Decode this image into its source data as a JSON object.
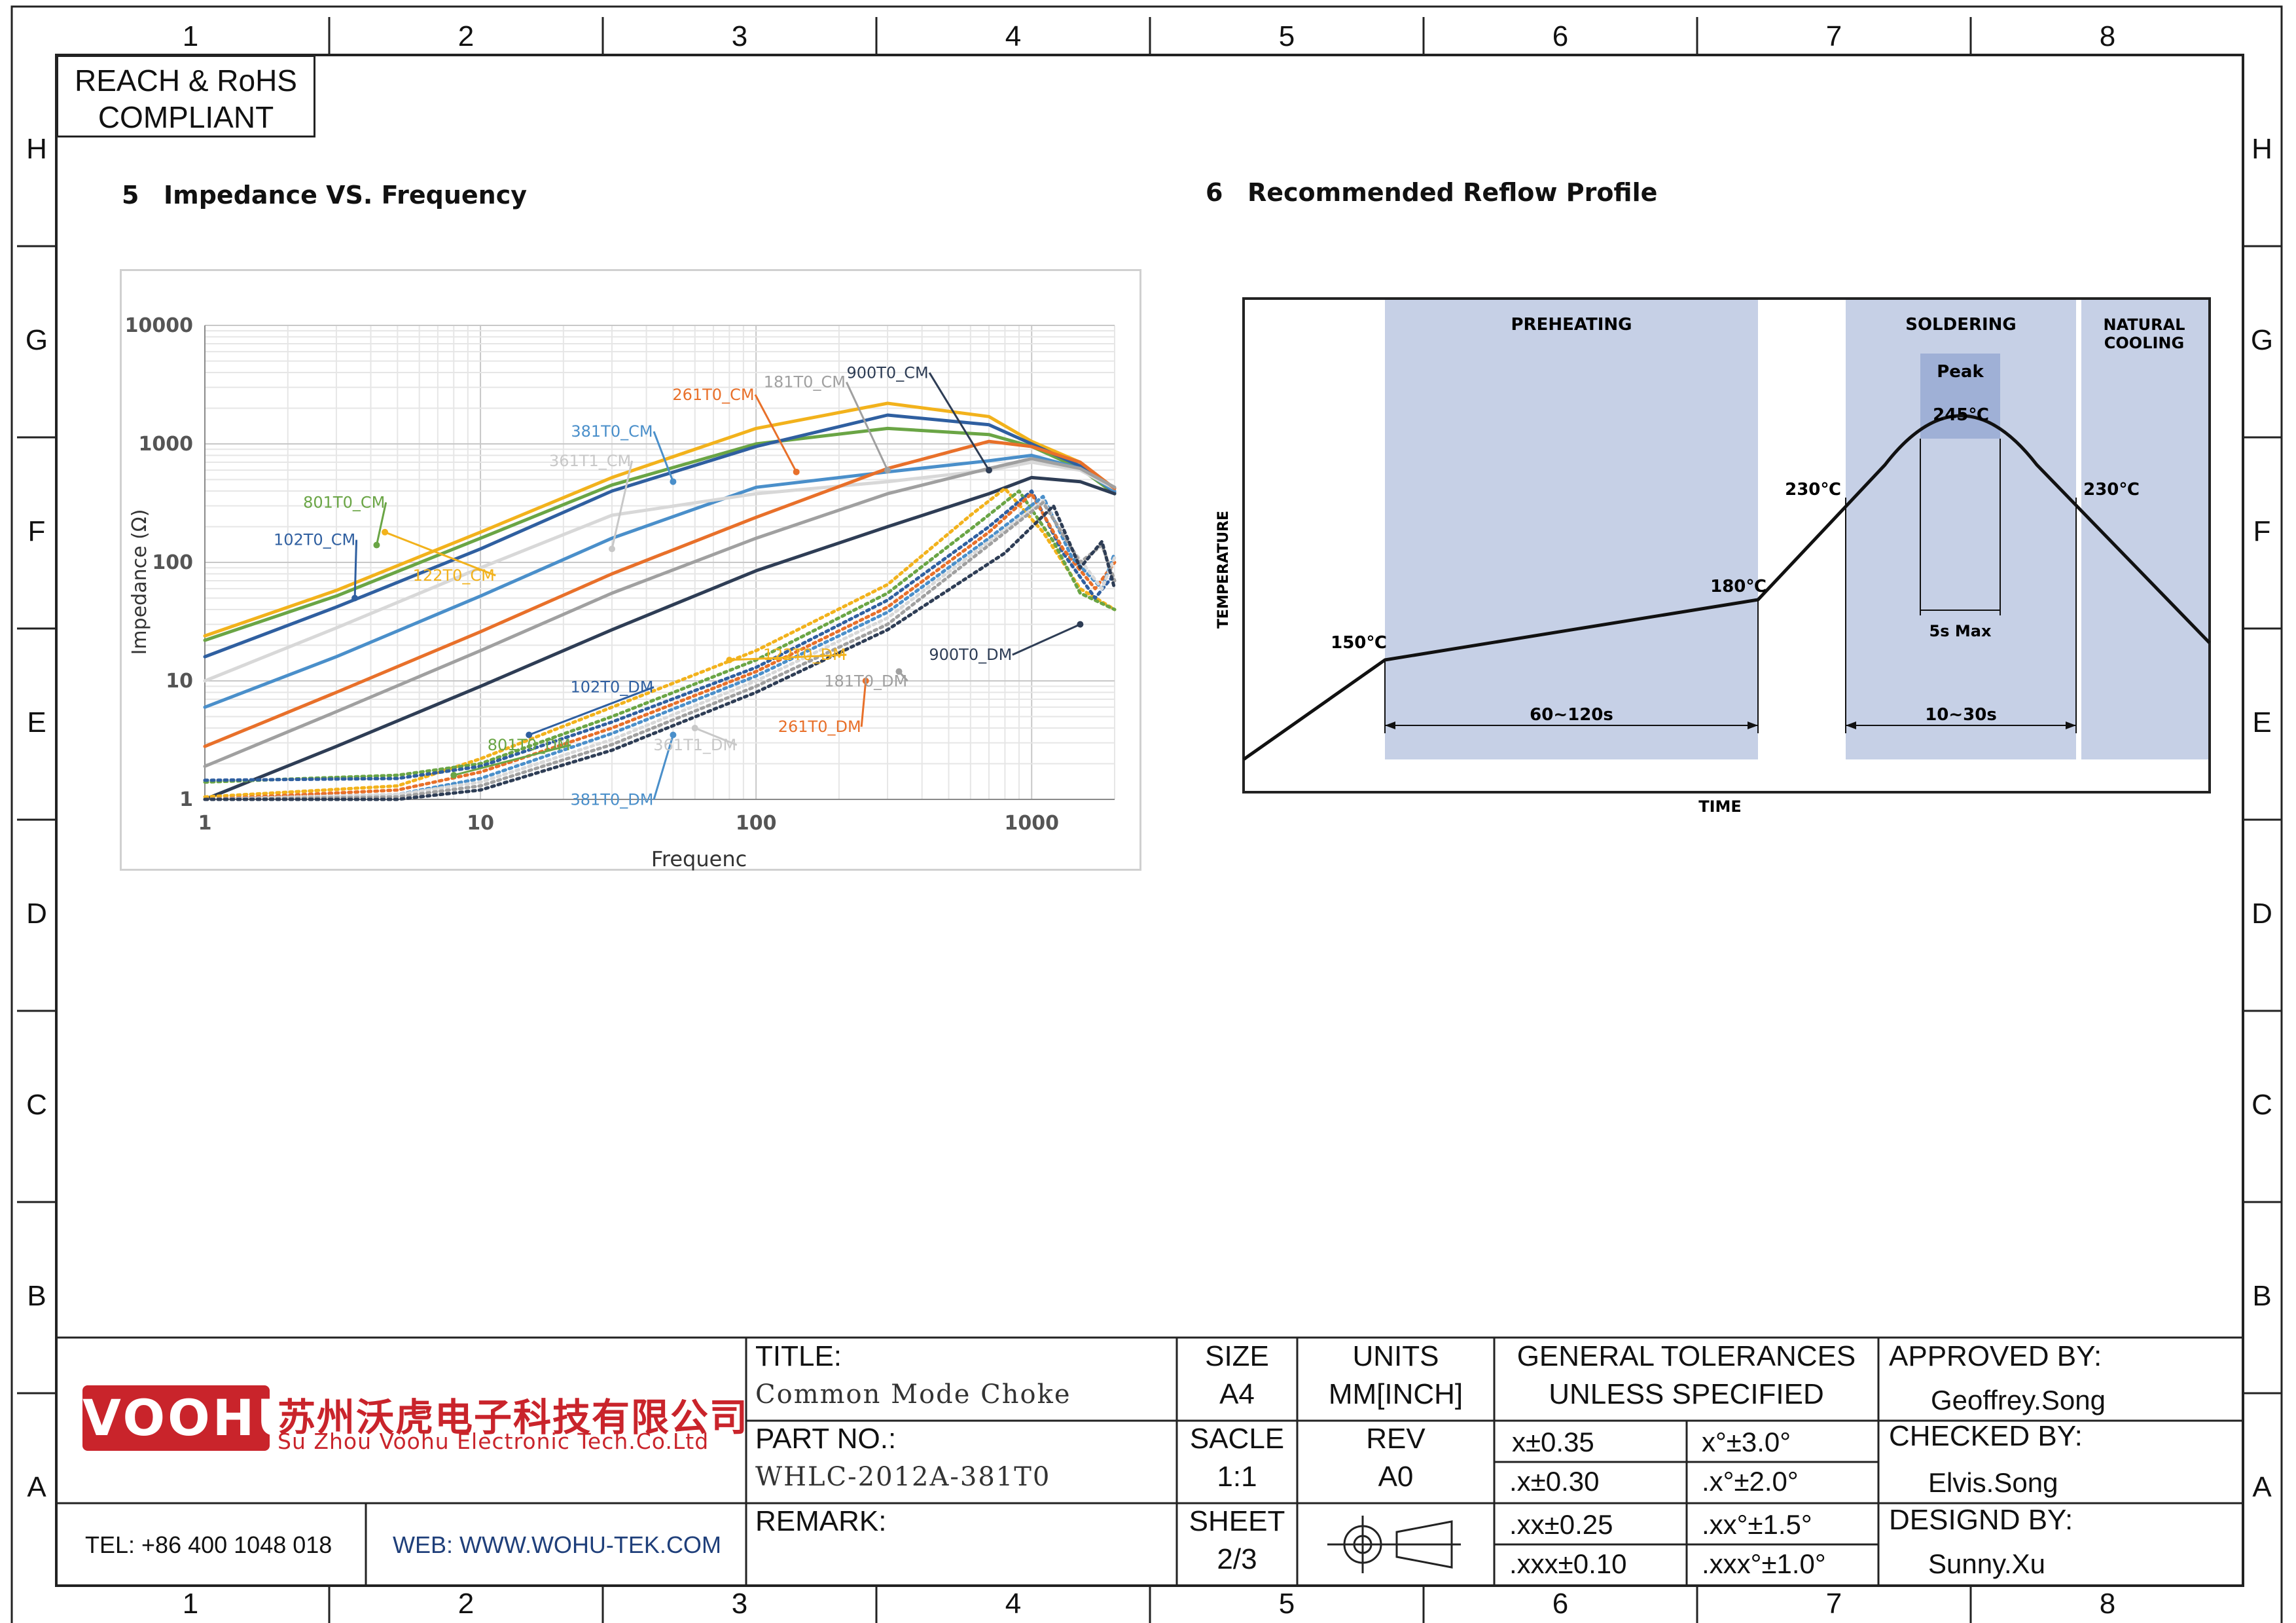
{
  "zones": {
    "columns": [
      "1",
      "2",
      "3",
      "4",
      "5",
      "6",
      "7",
      "8"
    ],
    "rows": [
      "H",
      "G",
      "F",
      "E",
      "D",
      "C",
      "B",
      "A"
    ]
  },
  "compliance": {
    "line1": "REACH & RoHS",
    "line2": "COMPLIANT"
  },
  "section5": {
    "number": "5",
    "title": "Impedance VS. Frequency"
  },
  "section6": {
    "number": "6",
    "title": "Recommended Reflow Profile"
  },
  "chart_data": [
    {
      "type": "line",
      "title": "",
      "xlabel": "Frequenc",
      "ylabel": "Impedance (Ω)",
      "xscale": "log",
      "yscale": "log",
      "xlim": [
        1,
        2000
      ],
      "ylim": [
        1,
        10000
      ],
      "xticks": [
        "1",
        "10",
        "100",
        "1000"
      ],
      "yticks": [
        "1",
        "10",
        "100",
        "1000",
        "10000"
      ],
      "grid": true,
      "legend": "inline-labels",
      "series": [
        {
          "name": "122T0_CM",
          "color": "#f2b21c",
          "style": "solid",
          "x": [
            1,
            3,
            10,
            30,
            100,
            300,
            700,
            1000,
            1500,
            2000
          ],
          "y": [
            24,
            58,
            180,
            520,
            1350,
            2200,
            1700,
            1050,
            700,
            420
          ]
        },
        {
          "name": "801T0_CM",
          "color": "#6aa545",
          "style": "solid",
          "x": [
            1,
            3,
            10,
            30,
            100,
            300,
            700,
            1000,
            1500,
            2000
          ],
          "y": [
            22,
            52,
            160,
            450,
            1000,
            1350,
            1200,
            950,
            620,
            380
          ]
        },
        {
          "name": "102T0_CM",
          "color": "#2f5fa0",
          "style": "solid",
          "x": [
            1,
            3,
            10,
            30,
            100,
            300,
            700,
            1000,
            1500,
            2000
          ],
          "y": [
            16,
            42,
            130,
            400,
            950,
            1750,
            1450,
            1000,
            650,
            390
          ]
        },
        {
          "name": "381T0_CM",
          "color": "#4a8fca",
          "style": "solid",
          "x": [
            1,
            3,
            10,
            30,
            100,
            300,
            700,
            1000,
            1500,
            2000
          ],
          "y": [
            6,
            16,
            52,
            160,
            430,
            580,
            720,
            800,
            620,
            400
          ]
        },
        {
          "name": "361T1_CM",
          "color": "#d8d8d8",
          "style": "solid",
          "x": [
            1,
            3,
            10,
            30,
            100,
            300,
            700,
            1000,
            1500,
            2000
          ],
          "y": [
            10,
            28,
            90,
            250,
            380,
            480,
            600,
            700,
            600,
            420
          ]
        },
        {
          "name": "261T0_CM",
          "color": "#e8702a",
          "style": "solid",
          "x": [
            1,
            3,
            10,
            30,
            100,
            300,
            700,
            1000,
            1500,
            2000
          ],
          "y": [
            2.8,
            8,
            26,
            80,
            240,
            620,
            1050,
            950,
            700,
            420
          ]
        },
        {
          "name": "181T0_CM",
          "color": "#a0a0a0",
          "style": "solid",
          "x": [
            1,
            3,
            10,
            30,
            100,
            300,
            700,
            1000,
            1500,
            2000
          ],
          "y": [
            1.9,
            5.5,
            18,
            55,
            160,
            380,
            620,
            750,
            620,
            430
          ]
        },
        {
          "name": "900T0_CM",
          "color": "#2e3d55",
          "style": "solid",
          "x": [
            1,
            3,
            10,
            30,
            100,
            300,
            700,
            1000,
            1500,
            2000
          ],
          "y": [
            1,
            2.8,
            9,
            27,
            85,
            200,
            380,
            520,
            480,
            380
          ]
        },
        {
          "name": "122T0_DM",
          "color": "#f2b21c",
          "style": "dotted",
          "x": [
            1,
            5,
            10,
            30,
            100,
            300,
            600,
            800,
            1100,
            1500,
            2000
          ],
          "y": [
            1.05,
            1.3,
            2.2,
            6,
            18,
            65,
            250,
            420,
            180,
            60,
            40
          ]
        },
        {
          "name": "801T0_DM",
          "color": "#6aa545",
          "style": "dotted",
          "x": [
            1,
            5,
            10,
            30,
            100,
            300,
            650,
            900,
            1200,
            1500,
            2000
          ],
          "y": [
            1.4,
            1.6,
            2,
            5,
            15,
            55,
            220,
            400,
            150,
            55,
            40
          ]
        },
        {
          "name": "102T0_DM",
          "color": "#2f5fa0",
          "style": "dotted",
          "x": [
            1,
            5,
            10,
            30,
            100,
            300,
            700,
            1000,
            1300,
            1700,
            2000
          ],
          "y": [
            1.45,
            1.5,
            1.9,
            4.5,
            13,
            48,
            200,
            400,
            120,
            50,
            80
          ]
        },
        {
          "name": "261T0_DM",
          "color": "#e8702a",
          "style": "dotted",
          "x": [
            1,
            5,
            10,
            30,
            100,
            300,
            700,
            1000,
            1300,
            1700,
            2000
          ],
          "y": [
            1,
            1.2,
            1.7,
            4,
            12,
            42,
            180,
            380,
            130,
            60,
            100
          ]
        },
        {
          "name": "381T0_DM",
          "color": "#4a8fca",
          "style": "dotted",
          "x": [
            1,
            5,
            10,
            30,
            100,
            300,
            700,
            1100,
            1400,
            1800,
            2000
          ],
          "y": [
            1,
            1.1,
            1.5,
            3.6,
            11,
            38,
            160,
            360,
            110,
            60,
            120
          ]
        },
        {
          "name": "361T1_DM",
          "color": "#d8d8d8",
          "style": "dotted",
          "x": [
            1,
            5,
            10,
            30,
            100,
            300,
            700,
            1100,
            1400,
            1800,
            2000
          ],
          "y": [
            1,
            1.1,
            1.4,
            3.2,
            10,
            34,
            150,
            330,
            130,
            60,
            110
          ]
        },
        {
          "name": "181T0_DM",
          "color": "#a0a0a0",
          "style": "dotted",
          "x": [
            1,
            5,
            10,
            30,
            100,
            300,
            700,
            1100,
            1500,
            1800,
            2000
          ],
          "y": [
            1,
            1.05,
            1.3,
            2.9,
            9,
            30,
            140,
            320,
            100,
            140,
            70
          ]
        },
        {
          "name": "900T0_DM",
          "color": "#2e3d55",
          "style": "dotted",
          "x": [
            1,
            5,
            10,
            30,
            100,
            300,
            800,
            1200,
            1500,
            1800,
            2000
          ],
          "y": [
            1,
            1,
            1.2,
            2.6,
            8,
            27,
            120,
            300,
            90,
            150,
            60
          ]
        }
      ]
    },
    {
      "type": "line",
      "title": "",
      "xlabel": "TIME",
      "ylabel": "TEMPERATURE",
      "zones": [
        {
          "label": "PREHEATING"
        },
        {
          "label": "SOLDERING"
        },
        {
          "label": "NATURAL COOLING"
        },
        {
          "label": "Peak"
        }
      ],
      "points": [
        {
          "label": ""
        },
        {
          "label": "150℃"
        },
        {
          "label": "180℃"
        },
        {
          "label": "230℃"
        },
        {
          "label": "245℃"
        },
        {
          "label": "230℃"
        },
        {
          "label": ""
        }
      ],
      "durations": [
        "60~120s",
        "10~30s",
        "5s Max"
      ]
    }
  ],
  "titleblock": {
    "company_cn": "苏州沃虎电子科技有限公司",
    "company_en": "Su Zhou Voohu Electronic Tech.Co.Ltd",
    "logo_text": "VOOHU",
    "tel": "TEL: +86 400 1048 018",
    "web": "WEB: WWW.WOHU-TEK.COM",
    "title_label": "TITLE:",
    "title_value": "Common Mode Choke",
    "part_label": "PART NO.:",
    "part_value": "WHLC-2012A-381T0",
    "remark_label": "REMARK:",
    "size_label": "SIZE",
    "size_value": "A4",
    "units_label": "UNITS",
    "units_value": "MM[INCH]",
    "scale_label": "SACLE",
    "scale_value": "1:1",
    "rev_label": "REV",
    "rev_value": "A0",
    "sheet_label": "SHEET",
    "sheet_value": "2/3",
    "tol_line1": "GENERAL TOLERANCES",
    "tol_line2": "UNLESS SPECIFIED",
    "tolerances": [
      [
        "x±0.35",
        "x°±3.0°"
      ],
      [
        ".x±0.30",
        ".x°±2.0°"
      ],
      [
        ".xx±0.25",
        ".xx°±1.5°"
      ],
      [
        ".xxx±0.10",
        ".xxx°±1.0°"
      ]
    ],
    "approved_label": "APPROVED BY:",
    "approved_value": "Geoffrey.Song",
    "checked_label": "CHECKED BY:",
    "checked_value": "Elvis.Song",
    "designed_label": "DESIGND BY:",
    "designed_value": "Sunny.Xu"
  }
}
